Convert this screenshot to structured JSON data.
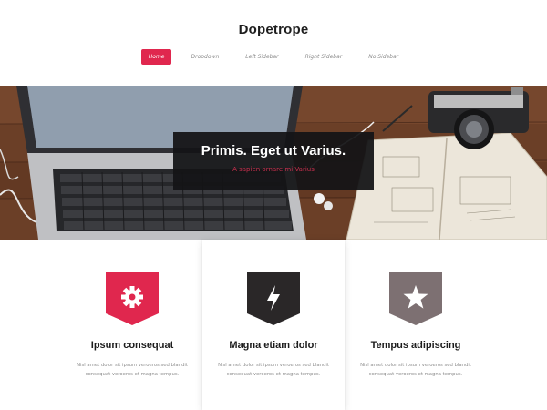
{
  "site": {
    "title": "Dopetrope"
  },
  "nav": {
    "items": [
      {
        "label": "Home",
        "active": true
      },
      {
        "label": "Dropdown",
        "active": false
      },
      {
        "label": "Left Sidebar",
        "active": false
      },
      {
        "label": "Right Sidebar",
        "active": false
      },
      {
        "label": "No Sidebar",
        "active": false
      }
    ]
  },
  "hero": {
    "title": "Primis. Eget ut Varius.",
    "subtitle": "A sapien ornare mi Varius"
  },
  "features": [
    {
      "title": "Ipsum consequat",
      "line1": "Nisl amet dolor sit ipsum veroeros sed blandit",
      "line2": "consequat veroeros et magna tempus.",
      "icon": "gear-icon",
      "color": "#e0274e"
    },
    {
      "title": "Magna etiam dolor",
      "line1": "Nisl amet dolor sit ipsum veroeros sed blandit",
      "line2": "consequat veroeros et magna tempus.",
      "icon": "bolt-icon",
      "color": "#2a2728"
    },
    {
      "title": "Tempus adipiscing",
      "line1": "Nisl amet dolor sit ipsum veroeros sed blandit",
      "line2": "consequat veroeros et magna tempus.",
      "icon": "star-icon",
      "color": "#7d7072"
    }
  ]
}
